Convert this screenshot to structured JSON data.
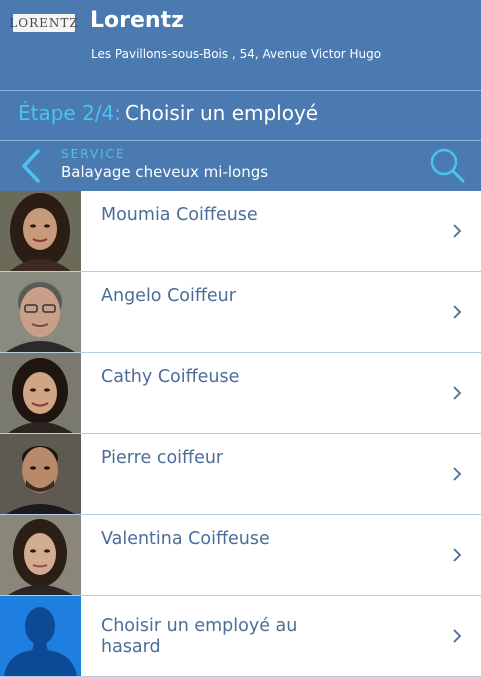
{
  "header": {
    "logo_text": "LORENTZ",
    "salon_name": "Lorentz",
    "address": "Les Pavillons-sous-Bois , 54, Avenue Victor Hugo"
  },
  "step": {
    "prefix": "Étape 2/4:",
    "title": "Choisir un employé"
  },
  "service": {
    "label": "SERVICE",
    "name": "Balayage cheveux mi-longs",
    "back_icon": "chevron-left-icon",
    "search_icon": "search-icon"
  },
  "employees": [
    {
      "name": "Moumia Coiffeuse"
    },
    {
      "name": "Angelo Coiffeur"
    },
    {
      "name": "Cathy Coiffeuse"
    },
    {
      "name": "Pierre coiffeur"
    },
    {
      "name": "Valentina Coiffeuse"
    },
    {
      "name": "Choisir un employé au hasard"
    }
  ],
  "colors": {
    "header_bg": "#4a7ab0",
    "accent": "#49c3f0",
    "name_text": "#4b6d98",
    "random_avatar_bg": "#1f7fe0"
  }
}
